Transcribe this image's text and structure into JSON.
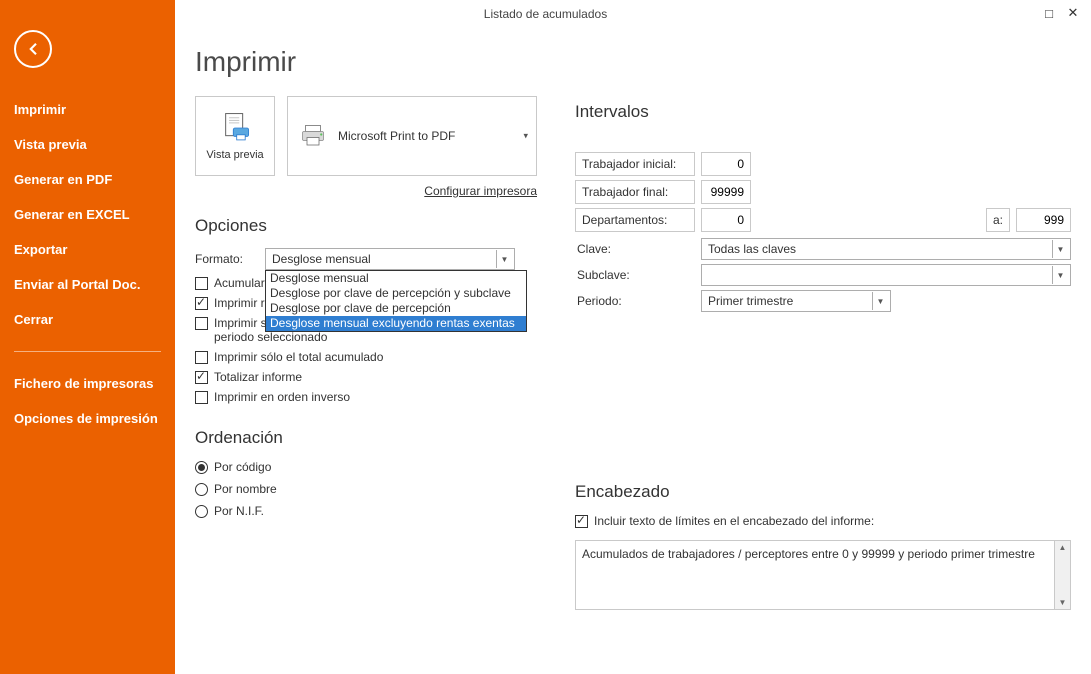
{
  "window": {
    "title": "Listado de acumulados"
  },
  "sidebar": {
    "items": [
      "Imprimir",
      "Vista previa",
      "Generar en PDF",
      "Generar en EXCEL",
      "Exportar",
      "Enviar al Portal Doc.",
      "Cerrar"
    ],
    "items2": [
      "Fichero de impresoras",
      "Opciones de impresión"
    ]
  },
  "page": {
    "title": "Imprimir",
    "preview_label": "Vista previa",
    "printer_name": "Microsoft Print to PDF",
    "configure_link": "Configurar impresora"
  },
  "opciones": {
    "heading": "Opciones",
    "formato_label": "Formato:",
    "formato_value": "Desglose mensual",
    "formato_options": [
      "Desglose mensual",
      "Desglose por clave de percepción y subclave",
      "Desglose por clave de percepción",
      "Desglose mensual excluyendo rentas exentas"
    ],
    "formato_selected_idx": 3,
    "chk_acumular": "Acumular e",
    "chk_imprimir_re": "Imprimir re",
    "chk_solo_info": "Imprimir sólo trabajadores que tengan información en el periodo seleccionado",
    "chk_solo_total": "Imprimir sólo el total acumulado",
    "chk_totalizar": "Totalizar informe",
    "chk_inverso": "Imprimir en orden inverso"
  },
  "ordenacion": {
    "heading": "Ordenación",
    "por_codigo": "Por código",
    "por_nombre": "Por nombre",
    "por_nif": "Por N.I.F."
  },
  "intervalos": {
    "heading": "Intervalos",
    "trab_inicial_label": "Trabajador inicial:",
    "trab_inicial_val": "0",
    "trab_final_label": "Trabajador final:",
    "trab_final_val": "99999",
    "dept_label": "Departamentos:",
    "dept_from": "0",
    "dept_a": "a:",
    "dept_to": "999",
    "clave_label": "Clave:",
    "clave_val": "Todas las claves",
    "subclave_label": "Subclave:",
    "subclave_val": "",
    "periodo_label": "Periodo:",
    "periodo_val": "Primer trimestre"
  },
  "encabezado": {
    "heading": "Encabezado",
    "chk_label": "Incluir texto de límites en el encabezado del informe:",
    "text": "Acumulados de trabajadores / perceptores entre 0 y 99999 y periodo primer trimestre"
  }
}
